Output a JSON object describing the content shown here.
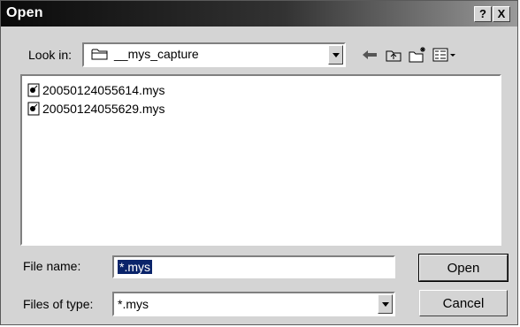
{
  "window": {
    "title": "Open"
  },
  "titlebar": {
    "help_label": "?",
    "close_label": "X"
  },
  "lookin": {
    "label": "Look in:",
    "value": "__mys_capture"
  },
  "toolbar": {
    "back_icon": "back-arrow-icon",
    "up_icon": "up-folder-icon",
    "new_folder_icon": "new-folder-icon",
    "view_icon": "view-menu-icon"
  },
  "files": [
    {
      "name": "20050124055614.mys"
    },
    {
      "name": "20050124055629.mys"
    }
  ],
  "filename": {
    "label": "File name:",
    "value": "*.mys"
  },
  "filetype": {
    "label": "Files of type:",
    "value": "*.mys"
  },
  "buttons": {
    "open": "Open",
    "cancel": "Cancel"
  }
}
